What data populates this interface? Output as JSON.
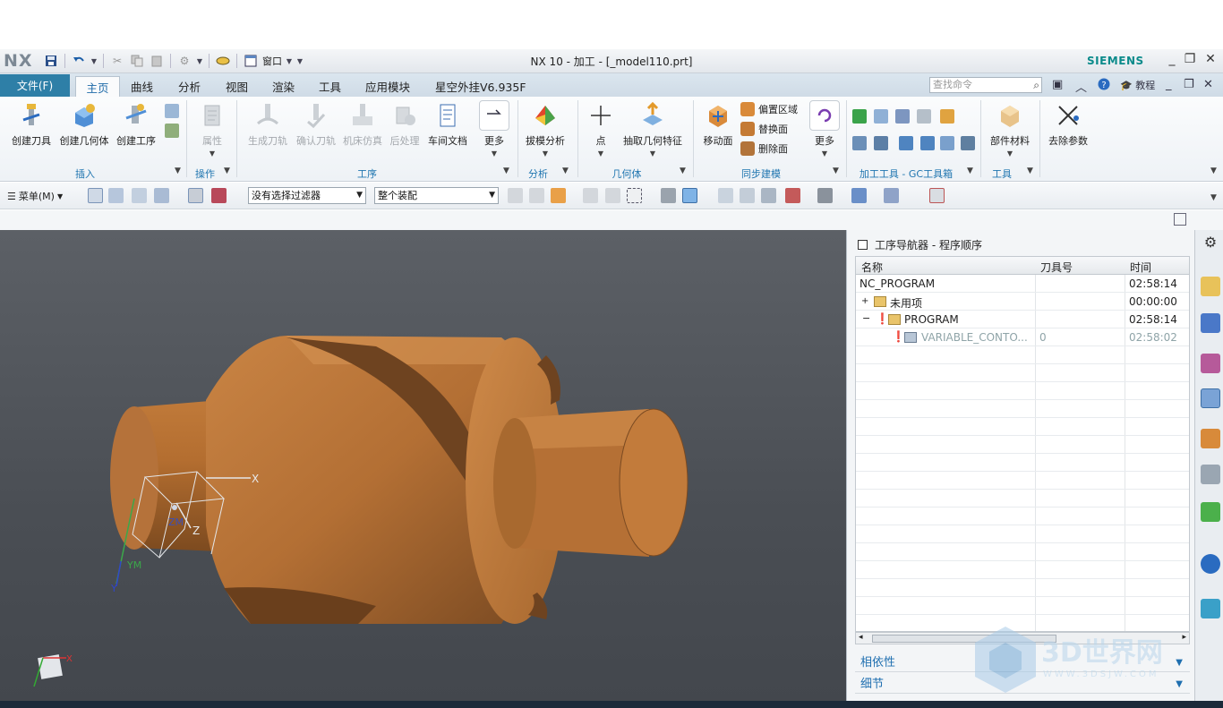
{
  "titlebar": {
    "logo": "NX",
    "window_menu": "窗口",
    "app_title": "NX 10 - 加工 - [_model110.prt]",
    "brand": "SIEMENS"
  },
  "tabs": {
    "file": "文件(F)",
    "items": [
      "主页",
      "曲线",
      "分析",
      "视图",
      "渲染",
      "工具",
      "应用模块",
      "星空外挂V6.935F"
    ],
    "search_placeholder": "查找命令",
    "tutorial": "教程"
  },
  "ribbon": {
    "insert": {
      "create_tool": "创建刀具",
      "create_geometry": "创建几何体",
      "create_operation": "创建工序",
      "group": "插入"
    },
    "operate": {
      "properties": "属性",
      "group": "操作"
    },
    "operation": {
      "generate_path": "生成刀轨",
      "verify_path": "确认刀轨",
      "machine_sim": "机床仿真",
      "postprocess": "后处理",
      "shop_doc": "车间文档",
      "more": "更多",
      "group": "工序"
    },
    "analysis": {
      "draft_analysis": "拔模分析",
      "group": "分析"
    },
    "geometry": {
      "point": "点",
      "extract_feature": "抽取几何特征",
      "group": "几何体"
    },
    "sync": {
      "move_face": "移动面",
      "offset_region": "偏置区域",
      "replace_face": "替换面",
      "delete_face": "删除面",
      "more": "更多",
      "group": "同步建模"
    },
    "gc": {
      "group": "加工工具 - GC工具箱"
    },
    "tools": {
      "part_material": "部件材料",
      "group": "工具"
    },
    "remove_params": "去除参数"
  },
  "toolbar": {
    "menu": "菜单(M)",
    "filter": "没有选择过滤器",
    "assembly": "整个装配"
  },
  "navigator": {
    "title": "工序导航器 - 程序顺序",
    "columns": [
      "名称",
      "刀具号",
      "时间"
    ],
    "rows": [
      {
        "name": "NC_PROGRAM",
        "tool": "",
        "time": "02:58:14"
      },
      {
        "name": "未用项",
        "tool": "",
        "time": "00:00:00"
      },
      {
        "name": "PROGRAM",
        "tool": "",
        "time": "02:58:14"
      },
      {
        "name": "VARIABLE_CONTO...",
        "tool": "0",
        "time": "02:58:02"
      }
    ],
    "dependencies": "相依性",
    "details": "细节"
  },
  "viewport": {
    "axis_x": "X",
    "axis_z": "Z",
    "axis_ym": "YM",
    "axis_y": "Y",
    "axis_zm": "ZM",
    "triad_x": "X"
  },
  "watermark": {
    "title": "3D世界网",
    "url": "WWW.3DSJW.COM"
  },
  "colors": {
    "accent": "#2e7fa7",
    "part": "#c27a3c",
    "viewport": "#55595f"
  }
}
